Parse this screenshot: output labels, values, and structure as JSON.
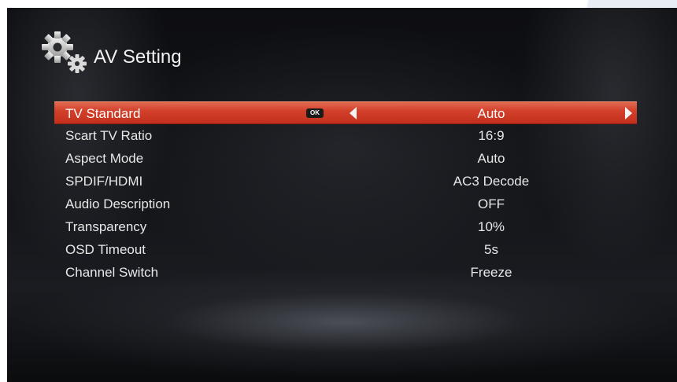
{
  "page": {
    "title": "AV Setting",
    "title_icon": "gears-icon"
  },
  "menu": {
    "ok_label": "OK",
    "items": [
      {
        "label": "TV Standard",
        "value": "Auto",
        "selected": true
      },
      {
        "label": "Scart TV Ratio",
        "value": "16:9"
      },
      {
        "label": "Aspect Mode",
        "value": "Auto"
      },
      {
        "label": "SPDIF/HDMI",
        "value": "AC3 Decode"
      },
      {
        "label": "Audio Description",
        "value": "OFF"
      },
      {
        "label": "Transparency",
        "value": "10%"
      },
      {
        "label": "OSD Timeout",
        "value": "5s"
      },
      {
        "label": "Channel Switch",
        "value": "Freeze"
      }
    ]
  },
  "colors": {
    "highlight": "#d3412b",
    "text": "#e8e8e8",
    "background": "#121317"
  }
}
